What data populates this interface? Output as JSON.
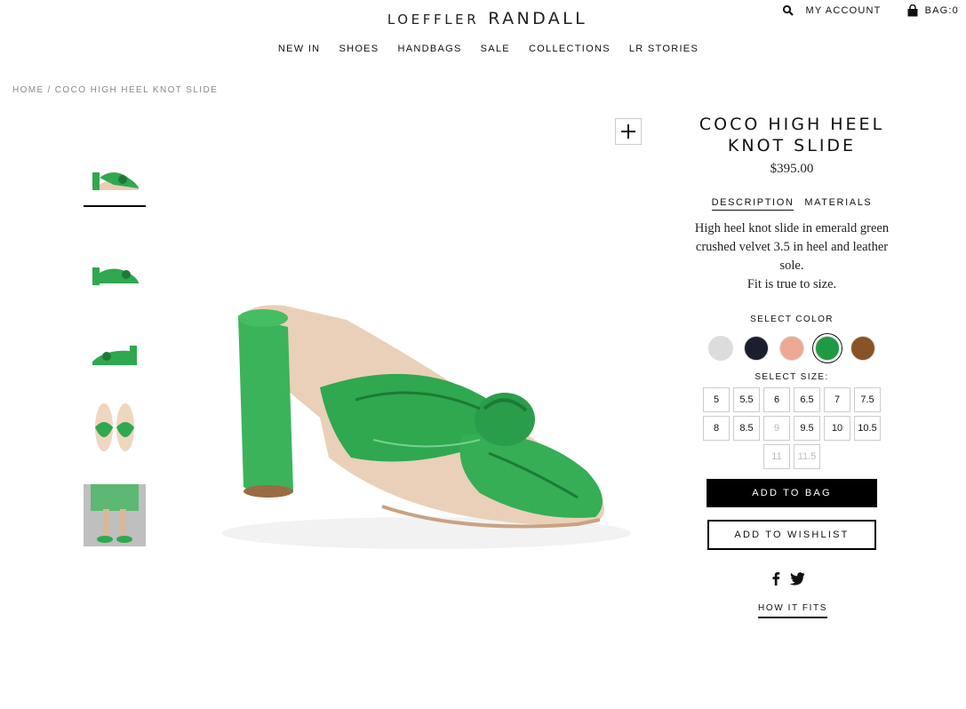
{
  "brand": {
    "part1": "LOEFFLER",
    "part2": "RANDALL"
  },
  "utility": {
    "account": "MY ACCOUNT",
    "bag": "BAG:0"
  },
  "nav": [
    "NEW IN",
    "SHOES",
    "HANDBAGS",
    "SALE",
    "COLLECTIONS",
    "LR STORIES"
  ],
  "breadcrumb": {
    "home": "HOME",
    "sep": "/",
    "current": "COCO HIGH HEEL KNOT SLIDE"
  },
  "product": {
    "title_line1": "COCO HIGH HEEL",
    "title_line2": "KNOT SLIDE",
    "price": "$395.00",
    "tabs": {
      "description": "DESCRIPTION",
      "materials": "MATERIALS"
    },
    "description": "High heel knot slide in emerald green crushed velvet 3.5 in heel and leather sole.",
    "fit": "Fit is true to size.",
    "color_label": "SELECT COLOR",
    "colors": [
      {
        "name": "silver",
        "hex": "#dcdcdc"
      },
      {
        "name": "navy",
        "hex": "#1b1e2e"
      },
      {
        "name": "blush",
        "hex": "#eda894"
      },
      {
        "name": "emerald",
        "hex": "#1f9a43"
      },
      {
        "name": "bronze",
        "hex": "#8a5326"
      }
    ],
    "selected_color": "emerald",
    "size_label": "SELECT SIZE:",
    "sizes": [
      {
        "label": "5",
        "available": true
      },
      {
        "label": "5.5",
        "available": true
      },
      {
        "label": "6",
        "available": true
      },
      {
        "label": "6.5",
        "available": true
      },
      {
        "label": "7",
        "available": true
      },
      {
        "label": "7.5",
        "available": true
      },
      {
        "label": "8",
        "available": true
      },
      {
        "label": "8.5",
        "available": true
      },
      {
        "label": "9",
        "available": false
      },
      {
        "label": "9.5",
        "available": true
      },
      {
        "label": "10",
        "available": true
      },
      {
        "label": "10.5",
        "available": true
      },
      {
        "label": "11",
        "available": false
      },
      {
        "label": "11.5",
        "available": false
      }
    ],
    "add_to_bag": "ADD TO BAG",
    "add_to_wishlist": "ADD TO WISHLIST",
    "how_it_fits": "HOW IT FITS"
  },
  "colors": {
    "shoe_green": "#2fa84f",
    "shoe_green_dark": "#1d7a36",
    "sole": "#e9c9ad",
    "heel_base": "#9a6b45"
  }
}
